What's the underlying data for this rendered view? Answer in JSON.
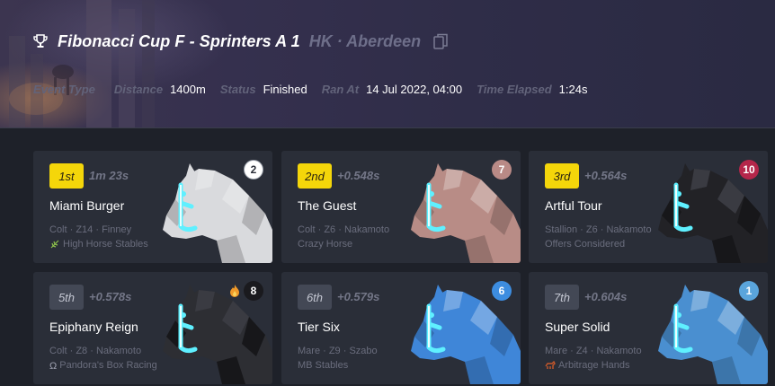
{
  "event": {
    "name": "Fibonacci Cup F - Sprinters A 1",
    "location": "HK · Aberdeen",
    "icons": {
      "trophy": "trophy-icon",
      "copy": "copy-icon"
    }
  },
  "meta": {
    "event_type_label": "Event Type",
    "distance_label": "Distance",
    "distance_value": "1400m",
    "status_label": "Status",
    "status_value": "Finished",
    "ran_at_label": "Ran At",
    "ran_at_value": "14 Jul 2022, 04:00",
    "time_elapsed_label": "Time Elapsed",
    "time_elapsed_value": "1:24s"
  },
  "colors": {
    "accent_yellow": "#f4d60a",
    "highlight_cyan": "#5ff0ff"
  },
  "results": [
    {
      "position": "1st",
      "time": "1m 23s",
      "name": "Miami Burger",
      "details": "Colt · Z14 · Finney",
      "stable": "High Horse Stables",
      "stable_icon": "wheat-icon",
      "gate": "2",
      "gate_color": "#ffffff",
      "coat": "#d9dadd",
      "top3": true
    },
    {
      "position": "2nd",
      "time": "+0.548s",
      "name": "The Guest",
      "details": "Colt · Z6 · Nakamoto",
      "stable": "Crazy Horse",
      "stable_icon": "",
      "gate": "7",
      "gate_color": "#b98a86",
      "coat": "#b88c86",
      "top3": true
    },
    {
      "position": "3rd",
      "time": "+0.564s",
      "name": "Artful Tour",
      "details": "Stallion · Z6 · Nakamoto",
      "stable": "Offers Considered",
      "stable_icon": "",
      "gate": "10",
      "gate_color": "#b4264a",
      "coat": "#222226",
      "top3": true
    },
    {
      "position": "5th",
      "time": "+0.578s",
      "name": "Epiphany Reign",
      "details": "Colt · Z8 · Nakamoto",
      "stable": "Pandora's Box Racing",
      "stable_icon": "omega-icon",
      "gate": "8",
      "gate_color": "#1a1a1e",
      "coat": "#2d2e33",
      "top3": false,
      "flame": true
    },
    {
      "position": "6th",
      "time": "+0.579s",
      "name": "Tier Six",
      "details": "Mare · Z9 · Szabo",
      "stable": "MB Stables",
      "stable_icon": "",
      "gate": "6",
      "gate_color": "#3d8de0",
      "coat": "#3f86d8",
      "top3": false
    },
    {
      "position": "7th",
      "time": "+0.604s",
      "name": "Super Solid",
      "details": "Mare · Z4 · Nakamoto",
      "stable": "Arbitrage Hands",
      "stable_icon": "horse-icon",
      "gate": "1",
      "gate_color": "#5aa5dc",
      "coat": "#4a8fd0",
      "top3": false
    }
  ]
}
